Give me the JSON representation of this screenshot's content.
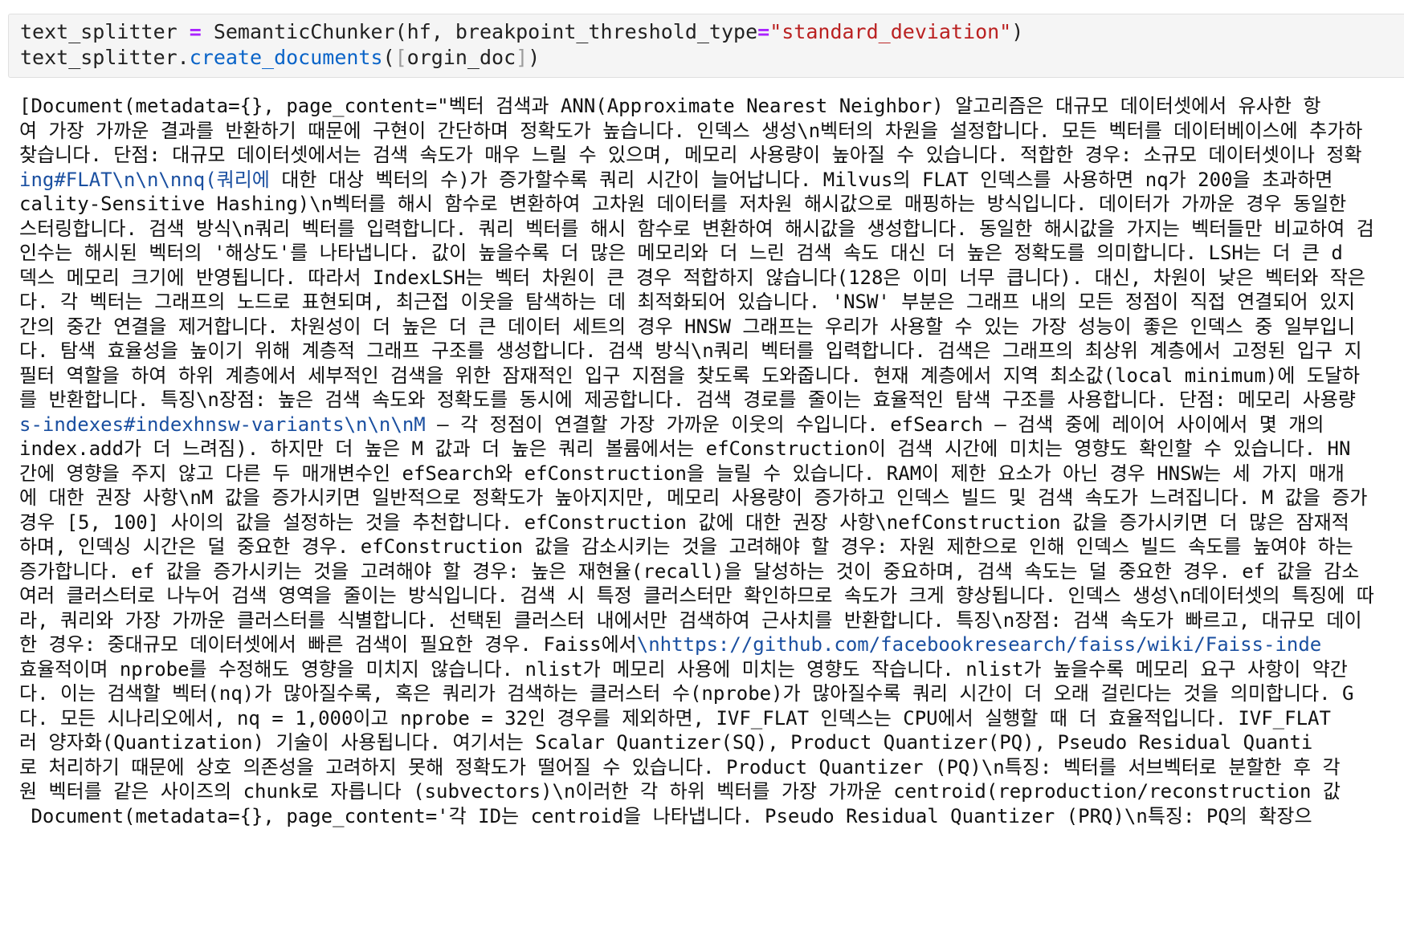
{
  "code_cell": {
    "line1": {
      "var": "text_splitter ",
      "op": "=",
      "call": " SemanticChunker(hf, breakpoint_threshold_type",
      "op2": "=",
      "str": "\"standard_deviation\"",
      "close": ")"
    },
    "line2": {
      "obj": "text_splitter.",
      "method": "create_documents",
      "open": "(",
      "bracket_open": "[",
      "arg": "orgin_doc",
      "bracket_close": "]",
      "close": ")"
    }
  },
  "output": {
    "lines": [
      {
        "a": "[Document(metadata={}, page_content=\"벡터 검색과 ANN(Approximate Nearest Neighbor) 알고리즘은 대규모 데이터셋에서 유사한 항",
        "link": "",
        "b": ""
      },
      {
        "a": "여 가장 가까운 결과를 반환하기 때문에 구현이 간단하며 정확도가 높습니다. 인덱스 생성\\n벡터의 차원을 설정합니다. 모든 벡터를 데이터베이스에 추가하",
        "link": "",
        "b": ""
      },
      {
        "a": "찾습니다. 단점: 대규모 데이터셋에서는 검색 속도가 매우 느릴 수 있으며, 메모리 사용량이 높아질 수 있습니다. 적합한 경우: 소규모 데이터셋이나 정확",
        "link": "",
        "b": ""
      },
      {
        "a": "",
        "link": "ing#FLAT\\n\\n\\nnq(쿼리에",
        "b": " 대한 대상 벡터의 수)가 증가할수록 쿼리 시간이 늘어납니다. Milvus의 FLAT 인덱스를 사용하면 nq가 200을 초과하면"
      },
      {
        "a": "cality-Sensitive Hashing)\\n벡터를 해시 함수로 변환하여 고차원 데이터를 저차원 해시값으로 매핑하는 방식입니다. 데이터가 가까운 경우 동일한",
        "link": "",
        "b": ""
      },
      {
        "a": "스터링합니다. 검색 방식\\n쿼리 벡터를 입력합니다. 쿼리 벡터를 해시 함수로 변환하여 해시값을 생성합니다. 동일한 해시값을 가지는 벡터들만 비교하여 검",
        "link": "",
        "b": ""
      },
      {
        "a": "인수는 해시된 벡터의 '해상도'를 나타냅니다. 값이 높을수록 더 많은 메모리와 더 느린 검색 속도 대신 더 높은 정확도를 의미합니다. LSH는 더 큰 d",
        "link": "",
        "b": ""
      },
      {
        "a": "덱스 메모리 크기에 반영됩니다. 따라서 IndexLSH는 벡터 차원이 큰 경우 적합하지 않습니다(128은 이미 너무 큽니다). 대신, 차원이 낮은 벡터와 작은",
        "link": "",
        "b": ""
      },
      {
        "a": "다. 각 벡터는 그래프의 노드로 표현되며, 최근접 이웃을 탐색하는 데 최적화되어 있습니다. 'NSW' 부분은 그래프 내의 모든 정점이 직접 연결되어 있지",
        "link": "",
        "b": ""
      },
      {
        "a": "간의 중간 연결을 제거합니다. 차원성이 더 높은 더 큰 데이터 세트의 경우 HNSW 그래프는 우리가 사용할 수 있는 가장 성능이 좋은 인덱스 중 일부입니",
        "link": "",
        "b": ""
      },
      {
        "a": "다. 탐색 효율성을 높이기 위해 계층적 그래프 구조를 생성합니다. 검색 방식\\n쿼리 벡터를 입력합니다. 검색은 그래프의 최상위 계층에서 고정된 입구 지",
        "link": "",
        "b": ""
      },
      {
        "a": "필터 역할을 하여 하위 계층에서 세부적인 검색을 위한 잠재적인 입구 지점을 찾도록 도와줍니다. 현재 계층에서 지역 최소값(local minimum)에 도달하",
        "link": "",
        "b": ""
      },
      {
        "a": "를 반환합니다. 특징\\n장점: 높은 검색 속도와 정확도를 동시에 제공합니다. 검색 경로를 줄이는 효율적인 탐색 구조를 사용합니다. 단점: 메모리 사용량",
        "link": "",
        "b": ""
      },
      {
        "a": "",
        "link": "s-indexes#indexhnsw-variants\\n\\n\\nM",
        "b": " – 각 정점이 연결할 가장 가까운 이웃의 수입니다. efSearch – 검색 중에 레이어 사이에서 몇 개의 "
      },
      {
        "a": "index.add가 더 느려짐). 하지만 더 높은 M 값과 더 높은 쿼리 볼륨에서는 efConstruction이 검색 시간에 미치는 영향도 확인할 수 있습니다. HN",
        "link": "",
        "b": ""
      },
      {
        "a": "간에 영향을 주지 않고 다른 두 매개변수인 efSearch와 efConstruction을 늘릴 수 있습니다. RAM이 제한 요소가 아닌 경우 HNSW는 세 가지 매개",
        "link": "",
        "b": ""
      },
      {
        "a": "에 대한 권장 사항\\nM 값을 증가시키면 일반적으로 정확도가 높아지지만, 메모리 사용량이 증가하고 인덱스 빌드 및 검색 속도가 느려집니다. M 값을 증가",
        "link": "",
        "b": ""
      },
      {
        "a": "경우 [5, 100] 사이의 값을 설정하는 것을 추천합니다. efConstruction 값에 대한 권장 사항\\nefConstruction 값을 증가시키면 더 많은 잠재적",
        "link": "",
        "b": ""
      },
      {
        "a": "하며, 인덱싱 시간은 덜 중요한 경우. efConstruction 값을 감소시키는 것을 고려해야 할 경우: 자원 제한으로 인해 인덱스 빌드 속도를 높여야 하는",
        "link": "",
        "b": ""
      },
      {
        "a": "증가합니다. ef 값을 증가시키는 것을 고려해야 할 경우: 높은 재현율(recall)을 달성하는 것이 중요하며, 검색 속도는 덜 중요한 경우. ef 값을 감소",
        "link": "",
        "b": ""
      },
      {
        "a": "여러 클러스터로 나누어 검색 영역을 줄이는 방식입니다. 검색 시 특정 클러스터만 확인하므로 속도가 크게 향상됩니다. 인덱스 생성\\n데이터셋의 특징에 따",
        "link": "",
        "b": ""
      },
      {
        "a": "라, 쿼리와 가장 가까운 클러스터를 식별합니다. 선택된 클러스터 내에서만 검색하여 근사치를 반환합니다. 특징\\n장점: 검색 속도가 빠르고, 대규모 데이",
        "link": "",
        "b": ""
      },
      {
        "a": "한 경우: 중대규모 데이터셋에서 빠른 검색이 필요한 경우. Faiss에서",
        "link": "\\nhttps://github.com/facebookresearch/faiss/wiki/Faiss-inde",
        "b": ""
      },
      {
        "a": "효율적이며 nprobe를 수정해도 영향을 미치지 않습니다. nlist가 메모리 사용에 미치는 영향도 작습니다. nlist가 높을수록 메모리 요구 사항이 약간",
        "link": "",
        "b": ""
      },
      {
        "a": "다. 이는 검색할 벡터(nq)가 많아질수록, 혹은 쿼리가 검색하는 클러스터 수(nprobe)가 많아질수록 쿼리 시간이 더 오래 걸린다는 것을 의미합니다. G",
        "link": "",
        "b": ""
      },
      {
        "a": "다. 모든 시나리오에서, nq = 1,000이고 nprobe = 32인 경우를 제외하면, IVF_FLAT 인덱스는 CPU에서 실행할 때 더 효율적입니다. IVF_FLAT",
        "link": "",
        "b": ""
      },
      {
        "a": "러 양자화(Quantization) 기술이 사용됩니다. 여기서는 Scalar Quantizer(SQ), Product Quantizer(PQ), Pseudo Residual Quanti",
        "link": "",
        "b": ""
      },
      {
        "a": "로 처리하기 때문에 상호 의존성을 고려하지 못해 정확도가 떨어질 수 있습니다. Product Quantizer (PQ)\\n특징: 벡터를 서브벡터로 분할한 후 각",
        "link": "",
        "b": ""
      },
      {
        "a": "원 벡터를 같은 사이즈의 chunk로 자릅니다 (subvectors)\\n이러한 각 하위 벡터를 가장 가까운 centroid(reproduction/reconstruction 값",
        "link": "",
        "b": ""
      },
      {
        "a": " Document(metadata={}, page_content='각 ID는 centroid을 나타냅니다. Pseudo Residual Quantizer (PRQ)\\n특징: PQ의 확장으",
        "link": "",
        "b": ""
      }
    ]
  }
}
